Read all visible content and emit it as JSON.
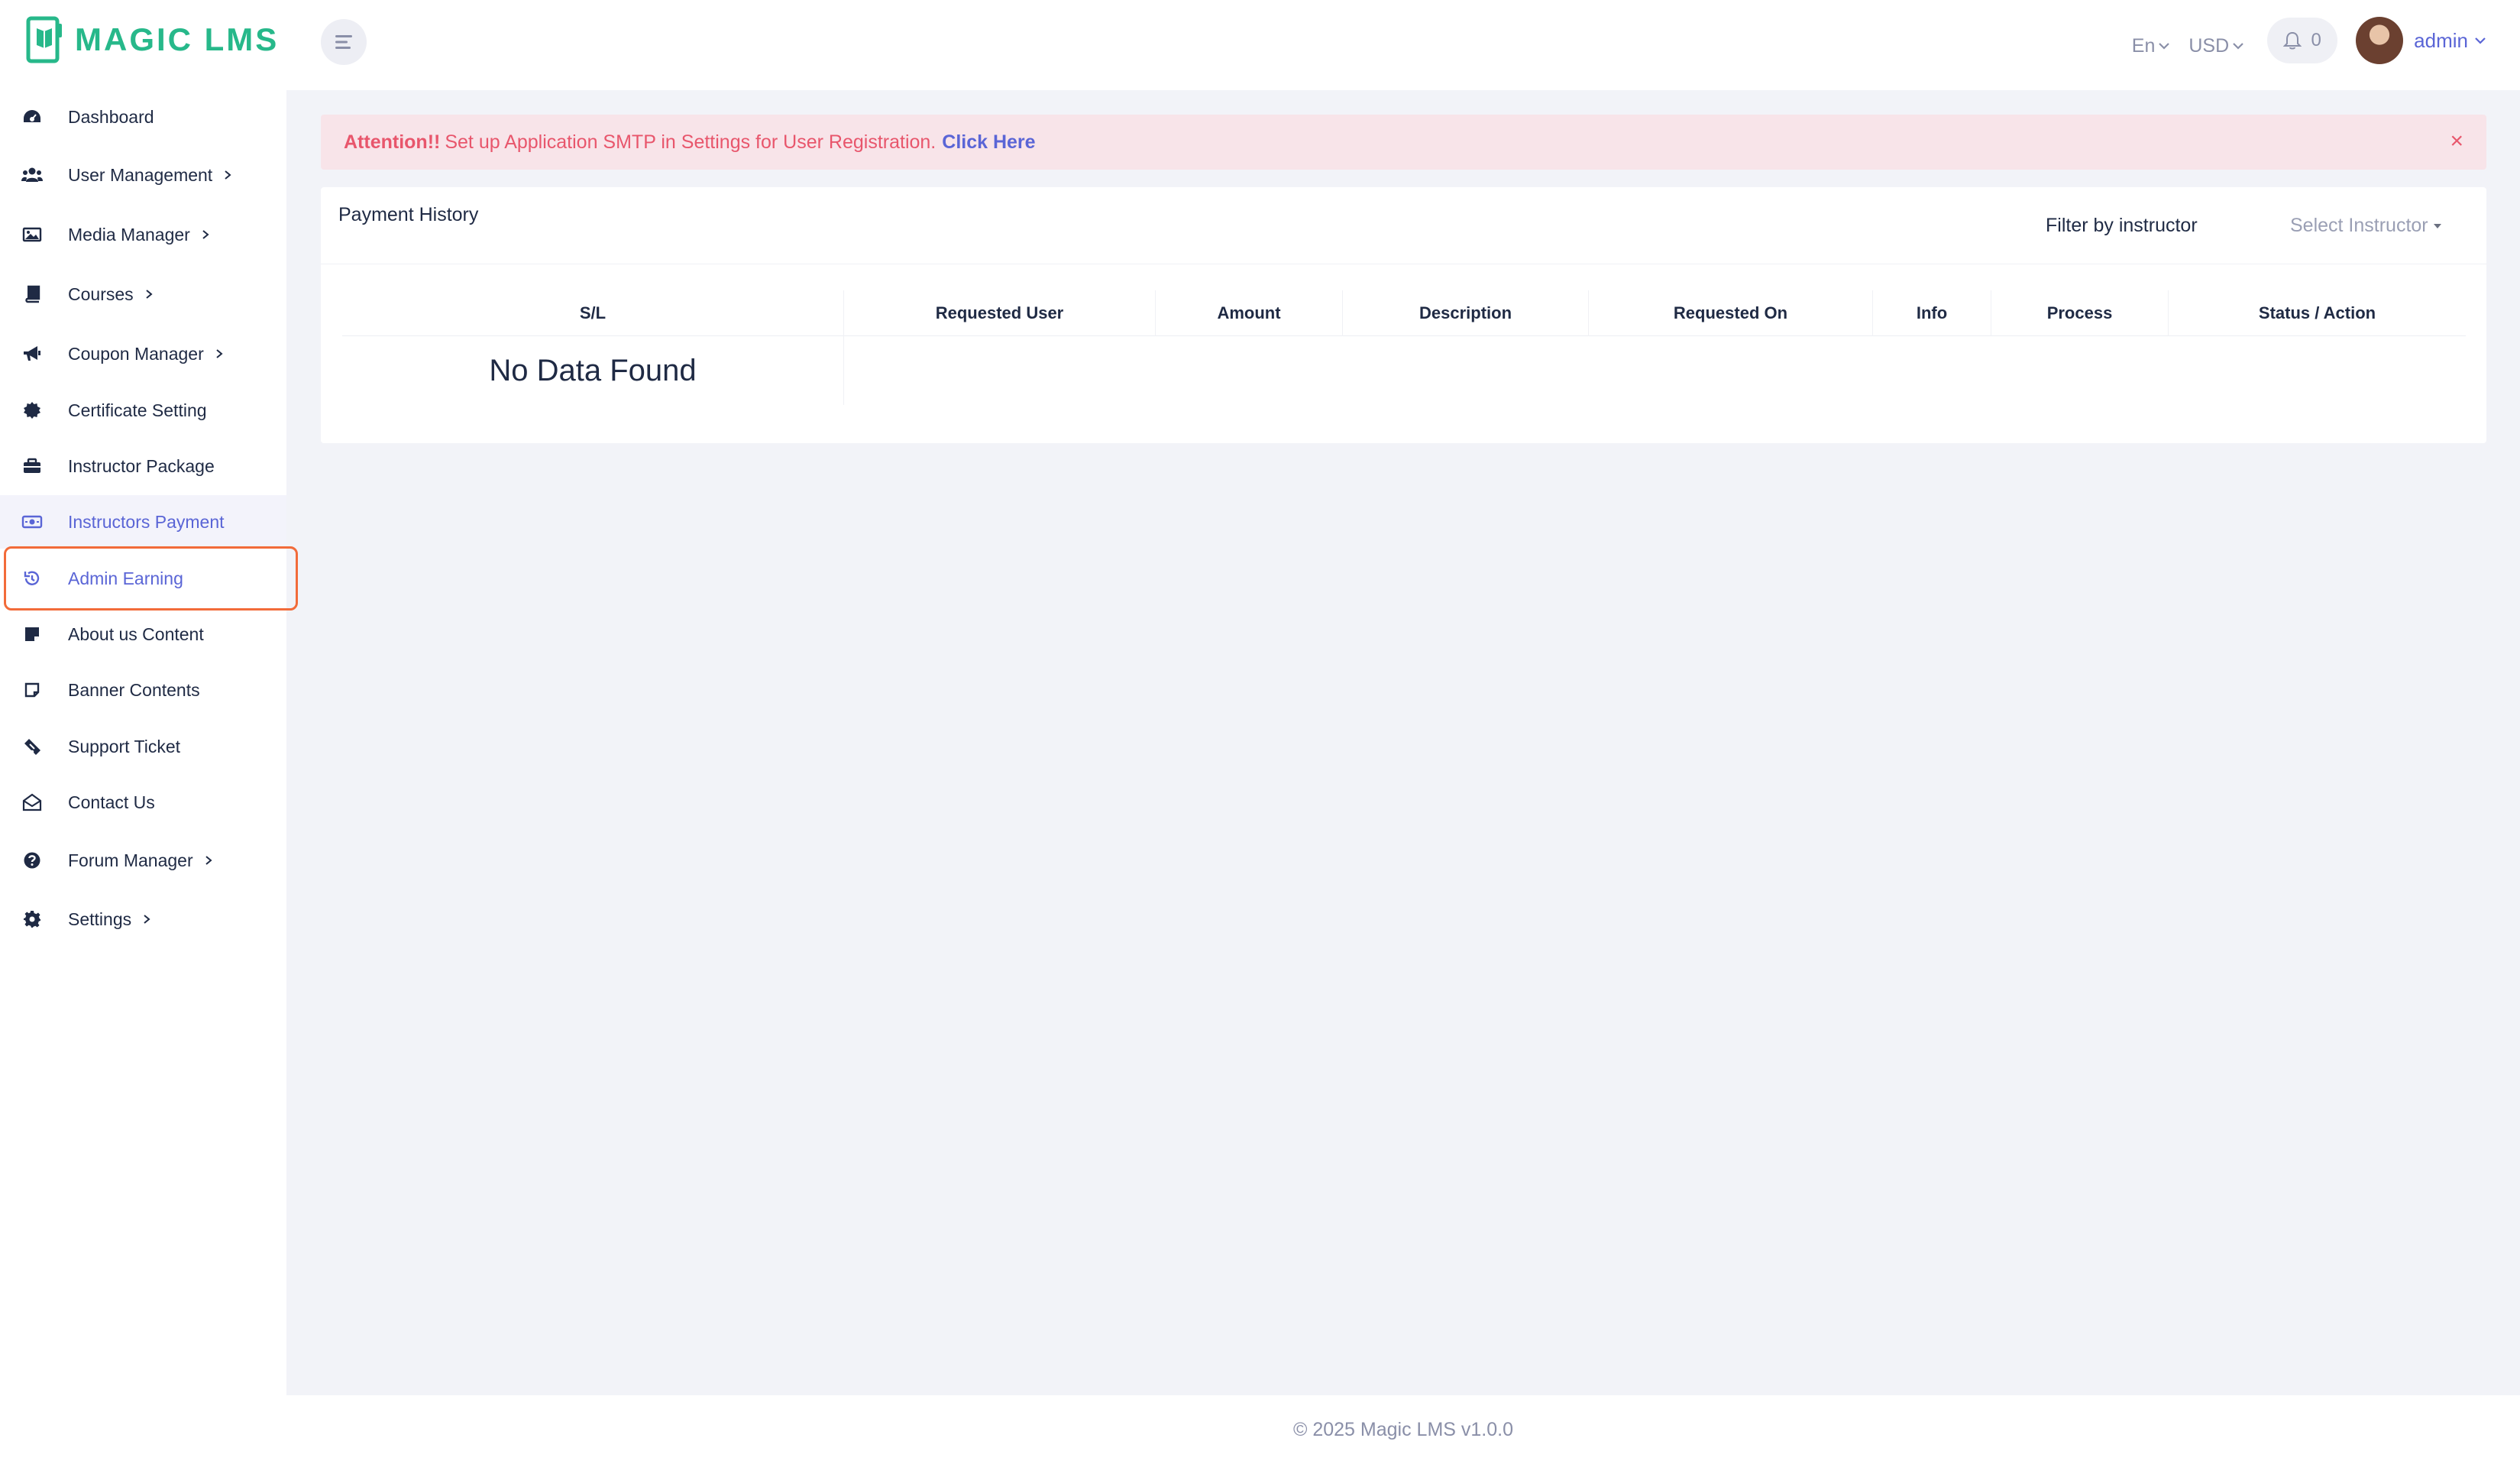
{
  "app": {
    "logo_text": "MAGIC LMS",
    "brand_color": "#27b88a",
    "accent_color": "#5a65d6"
  },
  "header": {
    "language": "En",
    "currency": "USD",
    "notifications_count": "0",
    "user_name": "admin"
  },
  "sidebar": {
    "items": [
      {
        "label": "Dashboard",
        "icon": "dashboard-icon",
        "has_submenu": false
      },
      {
        "label": "User Management",
        "icon": "users-icon",
        "has_submenu": true
      },
      {
        "label": "Media Manager",
        "icon": "image-icon",
        "has_submenu": true
      },
      {
        "label": "Courses",
        "icon": "book-icon",
        "has_submenu": true
      },
      {
        "label": "Coupon Manager",
        "icon": "megaphone-icon",
        "has_submenu": true
      },
      {
        "label": "Certificate Setting",
        "icon": "certificate-icon",
        "has_submenu": false
      },
      {
        "label": "Instructor Package",
        "icon": "briefcase-icon",
        "has_submenu": false
      },
      {
        "label": "Instructors Payment",
        "icon": "money-icon",
        "has_submenu": false
      },
      {
        "label": "Admin Earning",
        "icon": "history-icon",
        "has_submenu": false
      },
      {
        "label": "About us Content",
        "icon": "note-icon",
        "has_submenu": false
      },
      {
        "label": "Banner Contents",
        "icon": "sticky-note-icon",
        "has_submenu": false
      },
      {
        "label": "Support Ticket",
        "icon": "ticket-icon",
        "has_submenu": false
      },
      {
        "label": "Contact Us",
        "icon": "envelope-open-icon",
        "has_submenu": false
      },
      {
        "label": "Forum Manager",
        "icon": "question-circle-icon",
        "has_submenu": true
      },
      {
        "label": "Settings",
        "icon": "gear-icon",
        "has_submenu": true
      }
    ]
  },
  "alert": {
    "prefix": "Attention!!",
    "message": "Set up Application SMTP in Settings for User Registration.",
    "link_text": "Click Here",
    "close": "×"
  },
  "payment_history": {
    "title": "Payment History",
    "filter_label": "Filter by instructor",
    "filter_placeholder": "Select Instructor",
    "columns": [
      "S/L",
      "Requested User",
      "Amount",
      "Description",
      "Requested On",
      "Info",
      "Process",
      "Status / Action"
    ],
    "empty_text": "No Data Found"
  },
  "footer": {
    "text": "© 2025 Magic LMS v1.0.0"
  }
}
